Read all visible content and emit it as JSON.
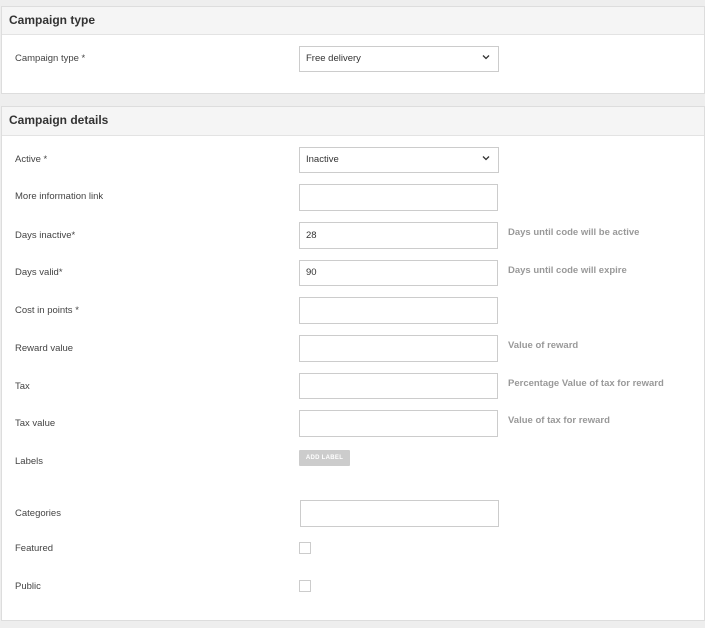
{
  "campaign_type_section": {
    "title": "Campaign type",
    "campaign_type_label": "Campaign type *",
    "campaign_type_value": "Free delivery"
  },
  "campaign_details_section": {
    "title": "Campaign details",
    "active_label": "Active *",
    "active_value": "Inactive",
    "more_info_label": "More information link",
    "more_info_value": "",
    "days_inactive_label": "Days inactive*",
    "days_inactive_value": "28",
    "days_inactive_hint": "Days until code will be active",
    "days_valid_label": "Days valid*",
    "days_valid_value": "90",
    "days_valid_hint": "Days until code will expire",
    "cost_points_label": "Cost in points *",
    "cost_points_value": "",
    "reward_value_label": "Reward value",
    "reward_value_value": "",
    "reward_value_hint": "Value of reward",
    "tax_label": "Tax",
    "tax_value_input": "",
    "tax_hint": "Percentage Value of tax for reward",
    "tax_value_label": "Tax value",
    "tax_value_value": "",
    "tax_value_hint": "Value of tax for reward",
    "labels_label": "Labels",
    "add_label_button": "ADD LABEL",
    "categories_label": "Categories",
    "categories_value": "",
    "featured_label": "Featured",
    "featured_checked": false,
    "public_label": "Public",
    "public_checked": false
  },
  "icons": {
    "dropdown": "chevron-down-icon"
  },
  "colors": {
    "panel_header_bg": "#f5f5f5",
    "border": "#cccccc",
    "hint_text": "#999999",
    "button_bg": "#cccccc"
  }
}
